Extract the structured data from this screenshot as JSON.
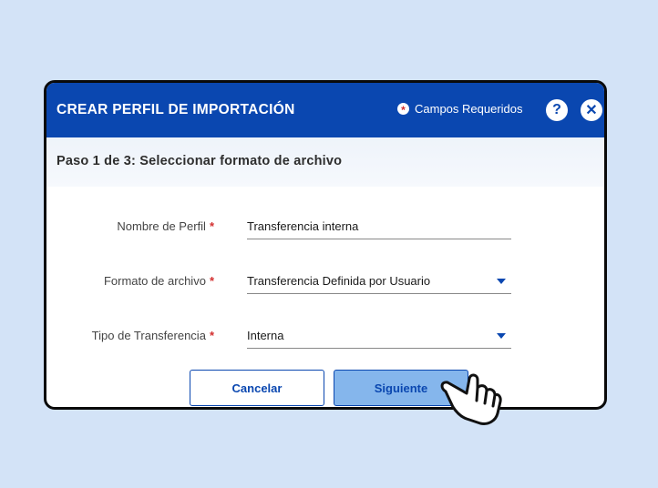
{
  "dialog": {
    "title": "CREAR PERFIL DE IMPORTACIÓN",
    "required_note": "Campos Requeridos",
    "required_marker": "*",
    "help_label": "?",
    "close_label": "✕"
  },
  "step": {
    "text": "Paso 1 de 3:  Seleccionar formato de archivo"
  },
  "form": {
    "required_marker": "*",
    "profile_name": {
      "label": "Nombre de Perfil",
      "value": "Transferencia interna"
    },
    "file_format": {
      "label": "Formato de archivo",
      "value": "Transferencia Definida por Usuario"
    },
    "transfer_type": {
      "label": "Tipo de Transferencia",
      "value": "Interna"
    }
  },
  "buttons": {
    "cancel": "Cancelar",
    "next": "Siguiente"
  },
  "colors": {
    "header": "#0a47b0",
    "background": "#d3e3f7",
    "required": "#d32f2f",
    "next_button": "#85b6ec"
  },
  "icons": {
    "required": "asterisk-icon",
    "help": "help-icon",
    "close": "close-icon",
    "dropdown": "chevron-down-icon",
    "cursor": "hand-pointer-icon"
  }
}
